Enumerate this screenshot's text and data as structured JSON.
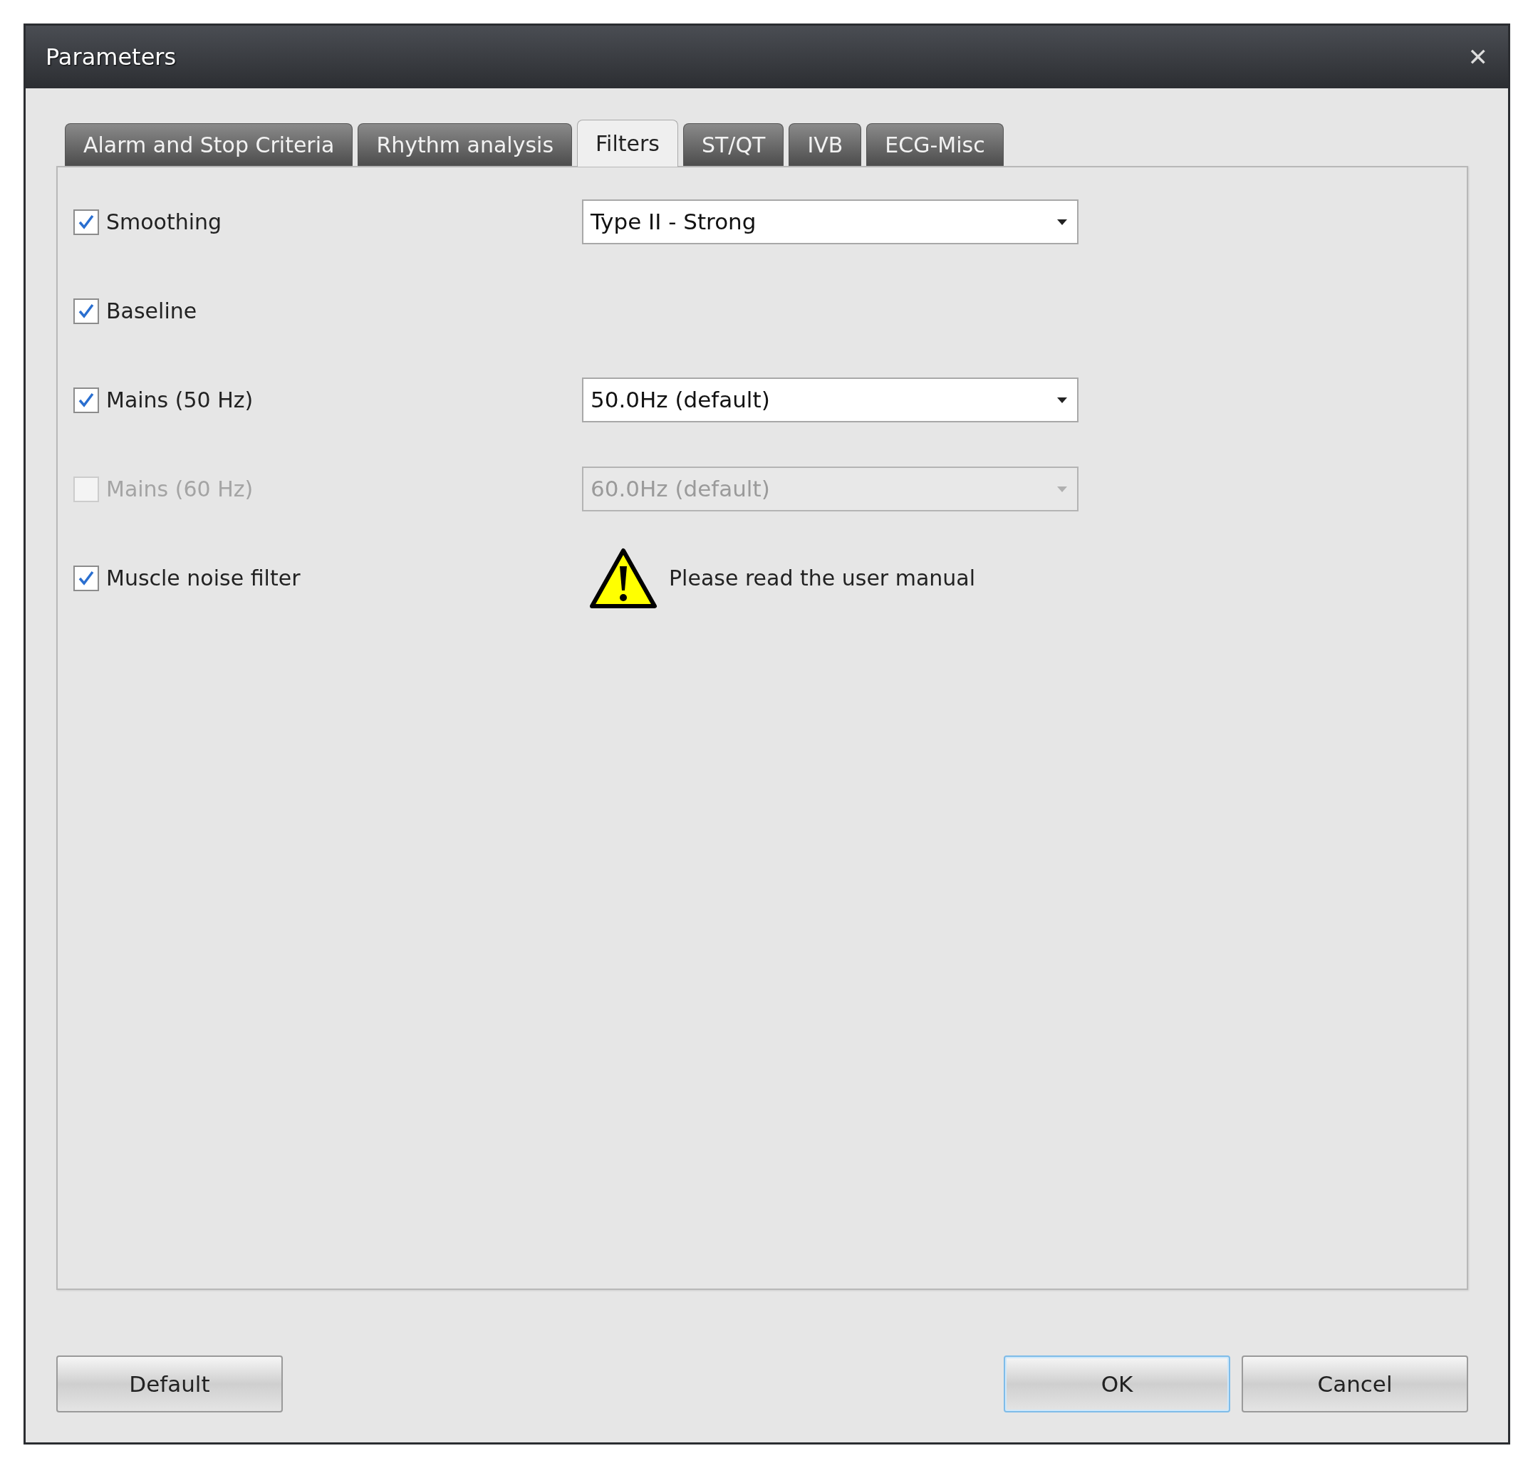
{
  "window": {
    "title": "Parameters",
    "close": "✕"
  },
  "tabs": [
    {
      "label": "Alarm and Stop Criteria",
      "selected": false
    },
    {
      "label": "Rhythm analysis",
      "selected": false
    },
    {
      "label": "Filters",
      "selected": true
    },
    {
      "label": "ST/QT",
      "selected": false
    },
    {
      "label": "IVB",
      "selected": false
    },
    {
      "label": "ECG-Misc",
      "selected": false
    }
  ],
  "filters": [
    {
      "kind": "dropdown",
      "label": "Smoothing",
      "checked": true,
      "disabled": false,
      "value": "Type II - Strong"
    },
    {
      "kind": "plain",
      "label": "Baseline",
      "checked": true,
      "disabled": false
    },
    {
      "kind": "dropdown",
      "label": "Mains (50 Hz)",
      "checked": true,
      "disabled": false,
      "value": "50.0Hz (default)"
    },
    {
      "kind": "dropdown",
      "label": "Mains (60 Hz)",
      "checked": false,
      "disabled": true,
      "value": "60.0Hz (default)"
    },
    {
      "kind": "warning",
      "label": "Muscle noise filter",
      "checked": true,
      "disabled": false,
      "message": "Please read the user manual"
    }
  ],
  "left_buttons": [
    {
      "label": "Default",
      "focused": false
    }
  ],
  "right_buttons": [
    {
      "label": "OK",
      "focused": true
    },
    {
      "label": "Cancel",
      "focused": false
    }
  ]
}
